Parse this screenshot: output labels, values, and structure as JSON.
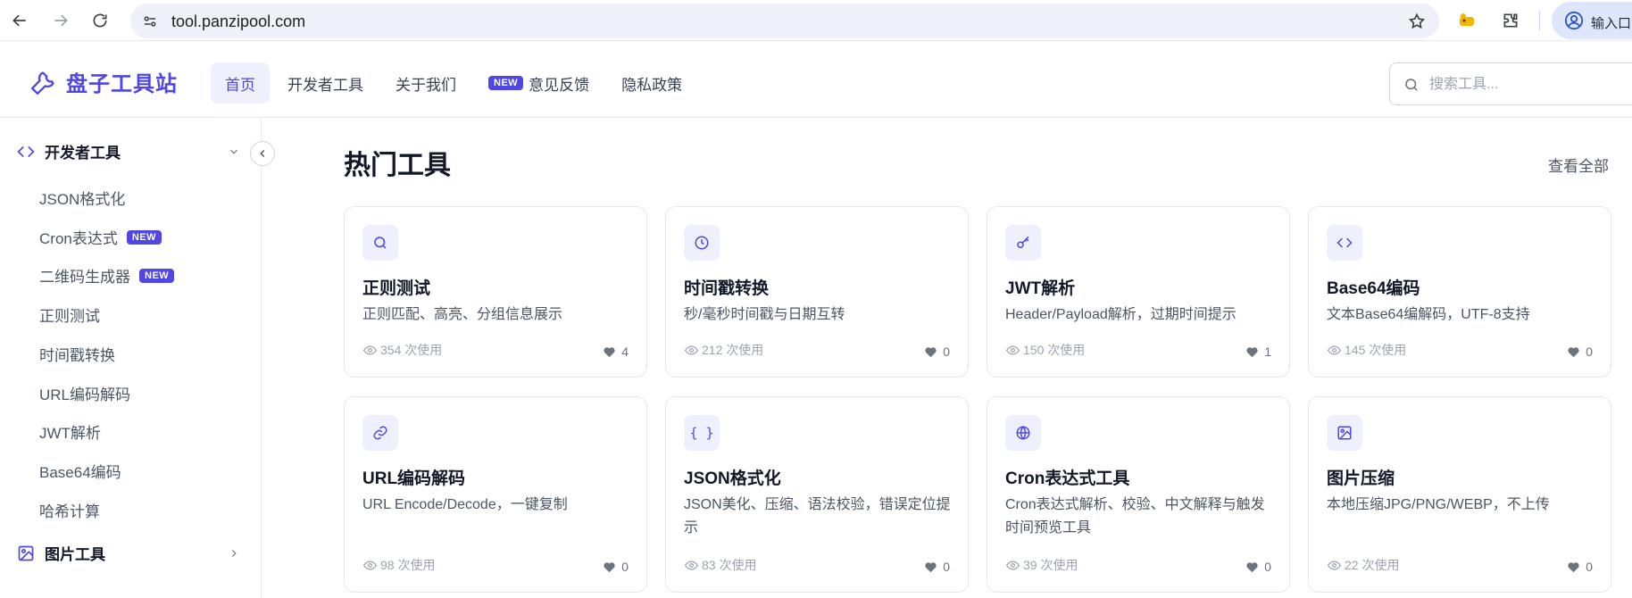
{
  "browser": {
    "url": "tool.panzipool.com",
    "profile_label": "输入口"
  },
  "header": {
    "logo_text": "盘子工具站",
    "nav": [
      {
        "label": "首页",
        "active": true
      },
      {
        "label": "开发者工具"
      },
      {
        "label": "关于我们"
      },
      {
        "label": "意见反馈",
        "badge": "NEW"
      },
      {
        "label": "隐私政策"
      }
    ],
    "search_placeholder": "搜索工具..."
  },
  "sidebar": {
    "groups": [
      {
        "label": "开发者工具",
        "expanded": true,
        "items": [
          {
            "label": "JSON格式化"
          },
          {
            "label": "Cron表达式",
            "badge": "NEW"
          },
          {
            "label": "二维码生成器",
            "badge": "NEW"
          },
          {
            "label": "正则测试"
          },
          {
            "label": "时间戳转换"
          },
          {
            "label": "URL编码解码"
          },
          {
            "label": "JWT解析"
          },
          {
            "label": "Base64编码"
          },
          {
            "label": "哈希计算"
          }
        ]
      },
      {
        "label": "图片工具",
        "expanded": false
      }
    ]
  },
  "main": {
    "section_title": "热门工具",
    "view_all": "查看全部",
    "cards": [
      {
        "icon": "search-icon",
        "title": "正则测试",
        "desc": "正则匹配、高亮、分组信息展示",
        "uses": "354 次使用",
        "likes": "4"
      },
      {
        "icon": "clock-icon",
        "title": "时间戳转换",
        "desc": "秒/毫秒时间戳与日期互转",
        "uses": "212 次使用",
        "likes": "0"
      },
      {
        "icon": "key-icon",
        "title": "JWT解析",
        "desc": "Header/Payload解析，过期时间提示",
        "uses": "150 次使用",
        "likes": "1"
      },
      {
        "icon": "code-icon",
        "title": "Base64编码",
        "desc": "文本Base64编解码，UTF-8支持",
        "uses": "145 次使用",
        "likes": "0"
      },
      {
        "icon": "link-icon",
        "title": "URL编码解码",
        "desc": "URL Encode/Decode，一键复制",
        "uses": "98 次使用",
        "likes": "0"
      },
      {
        "icon": "braces-icon",
        "icon_text": "{ }",
        "title": "JSON格式化",
        "desc": "JSON美化、压缩、语法校验，错误定位提示",
        "uses": "83 次使用",
        "likes": "0"
      },
      {
        "icon": "globe-icon",
        "title": "Cron表达式工具",
        "desc": "Cron表达式解析、校验、中文解释与触发时间预览工具",
        "uses": "39 次使用",
        "likes": "0"
      },
      {
        "icon": "image-icon",
        "title": "图片压缩",
        "desc": "本地压缩JPG/PNG/WEBP，不上传",
        "uses": "22 次使用",
        "likes": "0"
      }
    ]
  },
  "colors": {
    "accent": "#4f46e5",
    "accent_bg": "#eef0fd"
  }
}
